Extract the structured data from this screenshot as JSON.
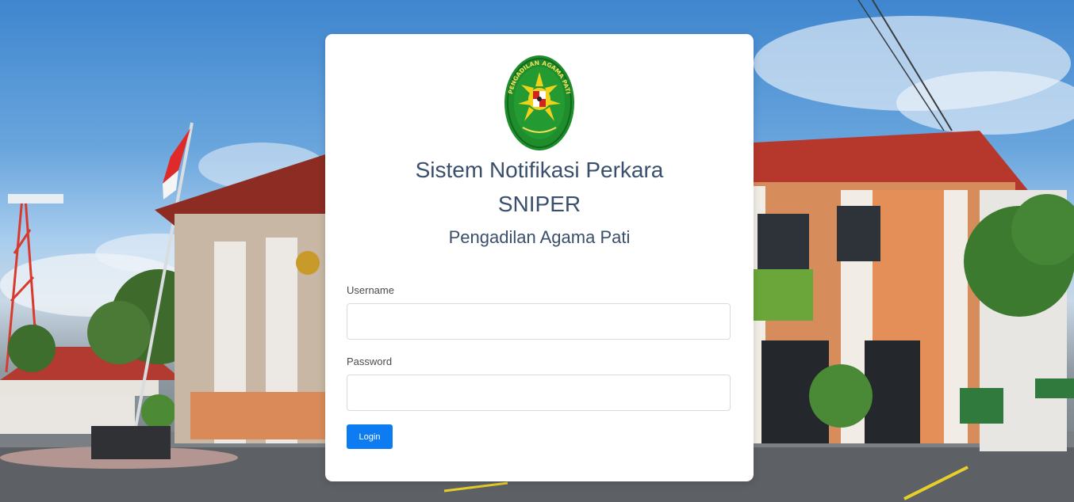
{
  "header": {
    "title": "Sistem Notifikasi Perkara",
    "app_name": "SNIPER",
    "institution": "Pengadilan Agama Pati"
  },
  "logo": {
    "ring_text": "PENGADILAN AGAMA PATI",
    "icon": "court-emblem-icon",
    "colors": {
      "outer": "#1f8d2c",
      "ring": "#0f6b1c",
      "sun": "#f2d11a",
      "text": "#f3e05a"
    }
  },
  "form": {
    "username_label": "Username",
    "username_value": "",
    "username_placeholder": "",
    "password_label": "Password",
    "password_value": "",
    "password_placeholder": "",
    "login_label": "Login"
  },
  "colors": {
    "title_text": "#3a4f6b",
    "button": "#0d7bf2",
    "card": "#ffffff"
  }
}
